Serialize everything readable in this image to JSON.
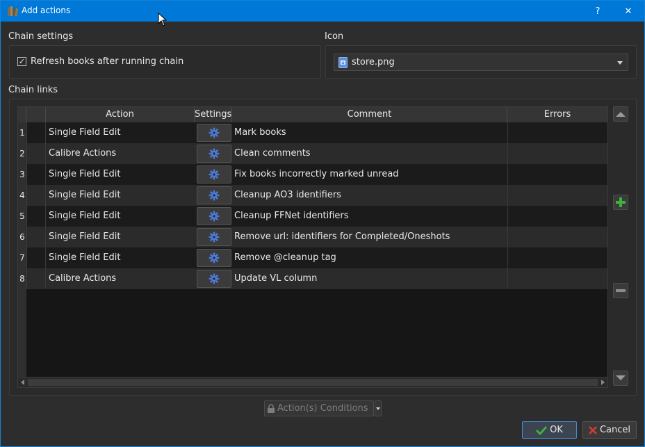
{
  "window": {
    "title": "Add actions",
    "help_label": "?",
    "close_label": "✕"
  },
  "chain_settings": {
    "label": "Chain settings",
    "refresh_checked": true,
    "refresh_label": "Refresh books after running chain"
  },
  "icon_section": {
    "label": "Icon",
    "selected": "store.png"
  },
  "chain_links": {
    "label": "Chain links",
    "columns": [
      "Action",
      "Settings",
      "Comment",
      "Errors"
    ],
    "rows": [
      {
        "num": "1",
        "action": "Single Field Edit",
        "comment": "Mark books",
        "errors": ""
      },
      {
        "num": "2",
        "action": "Calibre Actions",
        "comment": "Clean comments",
        "errors": ""
      },
      {
        "num": "3",
        "action": "Single Field Edit",
        "comment": "Fix books incorrectly marked unread",
        "errors": ""
      },
      {
        "num": "4",
        "action": "Single Field Edit",
        "comment": "Cleanup AO3 identifiers",
        "errors": ""
      },
      {
        "num": "5",
        "action": "Single Field Edit",
        "comment": "Cleanup FFNet identifiers",
        "errors": ""
      },
      {
        "num": "6",
        "action": "Single Field Edit",
        "comment": "Remove url: identifiers for Completed/Oneshots",
        "errors": ""
      },
      {
        "num": "7",
        "action": "Single Field Edit",
        "comment": "Remove @cleanup tag",
        "errors": ""
      },
      {
        "num": "8",
        "action": "Calibre Actions",
        "comment": "Update VL column",
        "errors": ""
      }
    ]
  },
  "conditions_button": {
    "label": "Action(s) Conditions"
  },
  "buttons": {
    "ok": "OK",
    "cancel": "Cancel"
  },
  "colors": {
    "titlebar": "#0078d7",
    "accent_green": "#3ab43a",
    "cancel_red": "#d83a3a",
    "gear_blue": "#4f7bd8"
  },
  "icons": {
    "app": "books-icon",
    "help": "help-icon",
    "close": "close-icon",
    "checkbox": "check-icon",
    "file": "png-file-icon",
    "gear": "gear-icon",
    "move_up": "arrow-up-icon",
    "add": "plus-icon",
    "remove": "minus-icon",
    "move_down": "arrow-down-icon",
    "lock": "lock-icon",
    "ok": "checkmark-icon",
    "cancel": "x-icon"
  }
}
